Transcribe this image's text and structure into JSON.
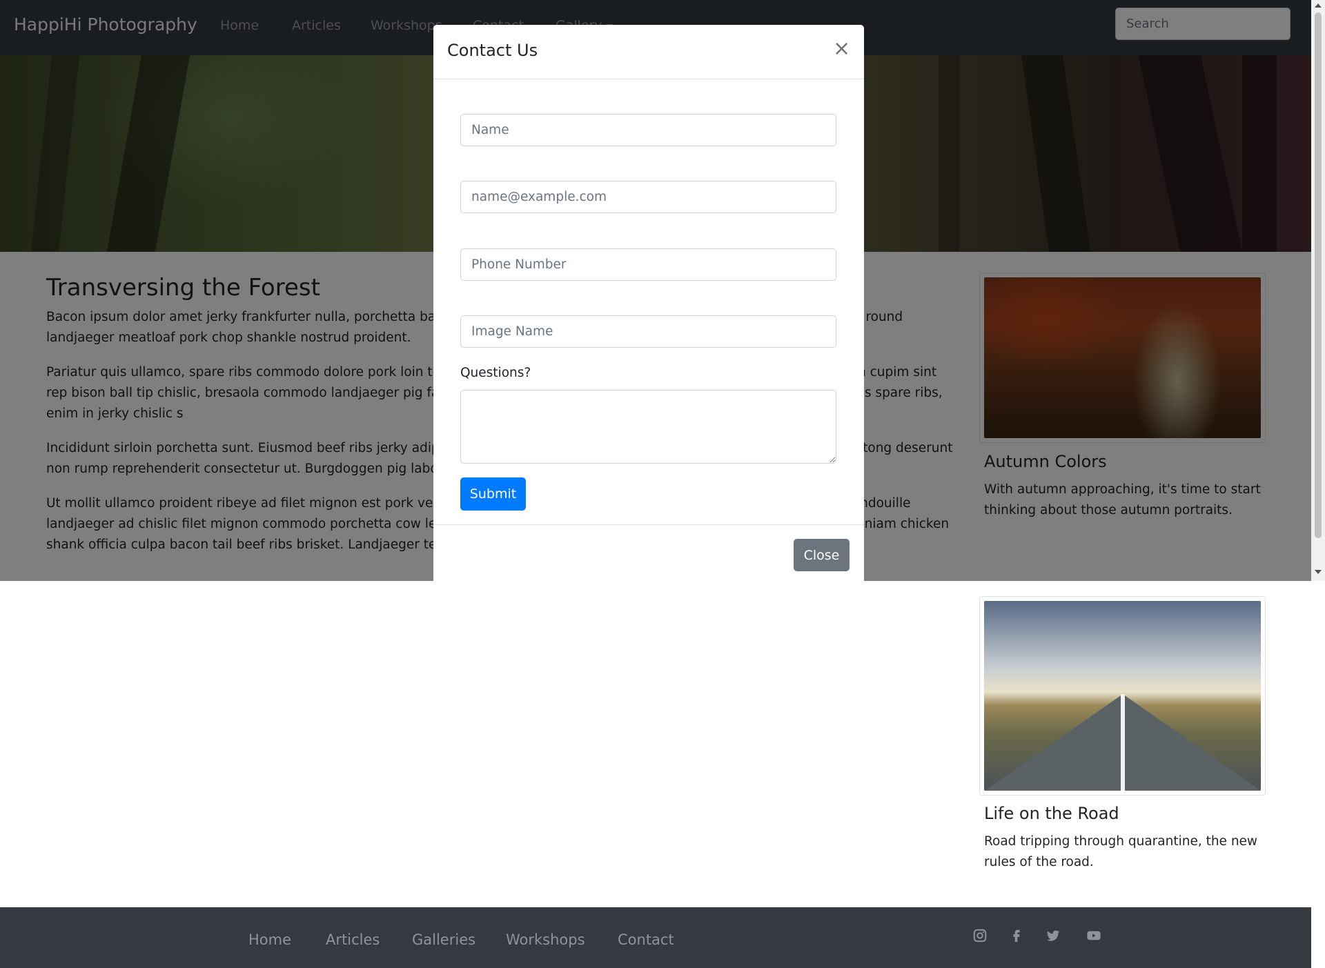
{
  "navbar": {
    "brand": "HappiHi Photography",
    "links": [
      "Home",
      "Articles",
      "Workshops",
      "Contact",
      "Gallery"
    ],
    "search_placeholder": "Search"
  },
  "article": {
    "title": "Transversing the Forest",
    "paragraphs": [
      "Bacon ipsum dolor amet jerky frankfurter nulla, porchetta bacon sunt id beef ribs et minim culpa ut in. Ex sirloin chislic, ground round landjaeger meatloaf pork chop shankle nostrud proident.",
      "Pariatur quis ullamco, spare ribs commodo dolore pork loin t-bone duis tri-tip. Pancetta est bresaola frankfurter turducken, anim cupim sint rep bison ball tip chislic, bresaola commodo landjaeger pig fatback do chuck ex fu alcatra doner. Picanha sausage anim beef ribs spare ribs, enim in jerky chislic s",
      "Incididunt sirloin porchetta sunt. Eiusmod beef ribs jerky adipisi i. Hamburger frankfurter boudin landjaeger occaecat. Aliqua biltong deserunt non rump reprehenderit consectetur ut. Burgdoggen pig labore pariatur.",
      "Ut mollit ullamco proident ribeye ad filet mignon est pork velit s empor nostrud aliquip. Short ribs frankfurter laborum laboris andouille landjaeger ad chislic filet mignon commodo porchetta cow leberkas pork belly ham hock. Pork chop non reprehenderit fugiat veniam chicken shank officia culpa bacon tail beef ribs brisket. Landjaeger tenderloin ribeye, ut ground round tempor frankfurter enim."
    ]
  },
  "sidebar": {
    "cards": [
      {
        "title": "Autumn Colors",
        "text": "With autumn approaching, it's time to start thinking about those autumn portraits."
      },
      {
        "title": "Life on the Road",
        "text": "Road tripping through quarantine, the new rules of the road."
      }
    ]
  },
  "footer": {
    "links": [
      "Home",
      "Articles",
      "Galleries",
      "Workshops",
      "Contact"
    ],
    "social_icons": [
      "instagram-icon",
      "facebook-icon",
      "twitter-icon",
      "youtube-icon"
    ]
  },
  "modal": {
    "title": "Contact Us",
    "close_symbol": "×",
    "name_placeholder": "Name",
    "email_placeholder": "name@example.com",
    "phone_placeholder": "Phone Number",
    "image_placeholder": "Image Name",
    "questions_label": "Questions?",
    "submit_label": "Submit",
    "close_label": "Close"
  },
  "colors": {
    "navbar_bg": "#343a40",
    "primary": "#007bff",
    "secondary": "#6c757d"
  }
}
